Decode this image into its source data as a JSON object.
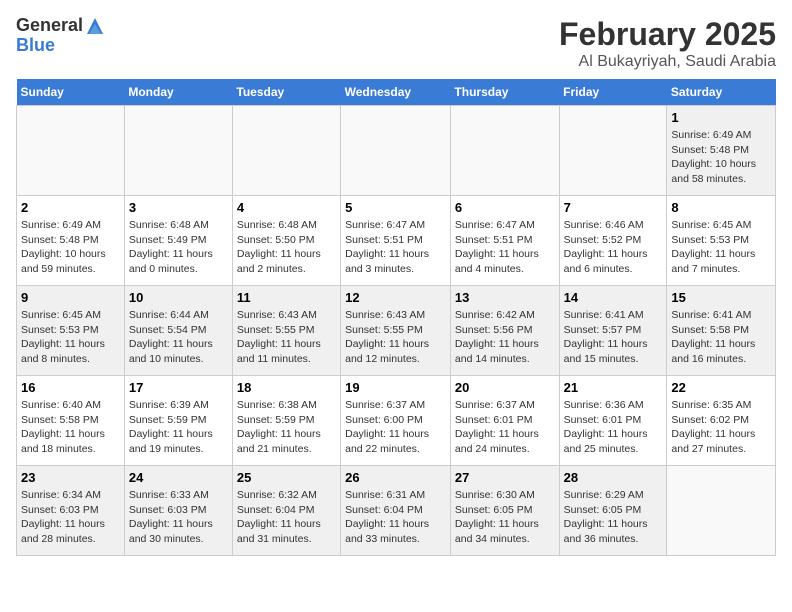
{
  "logo": {
    "general": "General",
    "blue": "Blue"
  },
  "title": "February 2025",
  "location": "Al Bukayriyah, Saudi Arabia",
  "days_of_week": [
    "Sunday",
    "Monday",
    "Tuesday",
    "Wednesday",
    "Thursday",
    "Friday",
    "Saturday"
  ],
  "weeks": [
    [
      {
        "day": "",
        "content": ""
      },
      {
        "day": "",
        "content": ""
      },
      {
        "day": "",
        "content": ""
      },
      {
        "day": "",
        "content": ""
      },
      {
        "day": "",
        "content": ""
      },
      {
        "day": "",
        "content": ""
      },
      {
        "day": "1",
        "content": "Sunrise: 6:49 AM\nSunset: 5:48 PM\nDaylight: 10 hours and 58 minutes."
      }
    ],
    [
      {
        "day": "2",
        "content": "Sunrise: 6:49 AM\nSunset: 5:48 PM\nDaylight: 10 hours and 59 minutes."
      },
      {
        "day": "3",
        "content": "Sunrise: 6:48 AM\nSunset: 5:49 PM\nDaylight: 11 hours and 0 minutes."
      },
      {
        "day": "4",
        "content": "Sunrise: 6:48 AM\nSunset: 5:50 PM\nDaylight: 11 hours and 2 minutes."
      },
      {
        "day": "5",
        "content": "Sunrise: 6:47 AM\nSunset: 5:51 PM\nDaylight: 11 hours and 3 minutes."
      },
      {
        "day": "6",
        "content": "Sunrise: 6:47 AM\nSunset: 5:51 PM\nDaylight: 11 hours and 4 minutes."
      },
      {
        "day": "7",
        "content": "Sunrise: 6:46 AM\nSunset: 5:52 PM\nDaylight: 11 hours and 6 minutes."
      },
      {
        "day": "8",
        "content": "Sunrise: 6:45 AM\nSunset: 5:53 PM\nDaylight: 11 hours and 7 minutes."
      }
    ],
    [
      {
        "day": "9",
        "content": "Sunrise: 6:45 AM\nSunset: 5:53 PM\nDaylight: 11 hours and 8 minutes."
      },
      {
        "day": "10",
        "content": "Sunrise: 6:44 AM\nSunset: 5:54 PM\nDaylight: 11 hours and 10 minutes."
      },
      {
        "day": "11",
        "content": "Sunrise: 6:43 AM\nSunset: 5:55 PM\nDaylight: 11 hours and 11 minutes."
      },
      {
        "day": "12",
        "content": "Sunrise: 6:43 AM\nSunset: 5:55 PM\nDaylight: 11 hours and 12 minutes."
      },
      {
        "day": "13",
        "content": "Sunrise: 6:42 AM\nSunset: 5:56 PM\nDaylight: 11 hours and 14 minutes."
      },
      {
        "day": "14",
        "content": "Sunrise: 6:41 AM\nSunset: 5:57 PM\nDaylight: 11 hours and 15 minutes."
      },
      {
        "day": "15",
        "content": "Sunrise: 6:41 AM\nSunset: 5:58 PM\nDaylight: 11 hours and 16 minutes."
      }
    ],
    [
      {
        "day": "16",
        "content": "Sunrise: 6:40 AM\nSunset: 5:58 PM\nDaylight: 11 hours and 18 minutes."
      },
      {
        "day": "17",
        "content": "Sunrise: 6:39 AM\nSunset: 5:59 PM\nDaylight: 11 hours and 19 minutes."
      },
      {
        "day": "18",
        "content": "Sunrise: 6:38 AM\nSunset: 5:59 PM\nDaylight: 11 hours and 21 minutes."
      },
      {
        "day": "19",
        "content": "Sunrise: 6:37 AM\nSunset: 6:00 PM\nDaylight: 11 hours and 22 minutes."
      },
      {
        "day": "20",
        "content": "Sunrise: 6:37 AM\nSunset: 6:01 PM\nDaylight: 11 hours and 24 minutes."
      },
      {
        "day": "21",
        "content": "Sunrise: 6:36 AM\nSunset: 6:01 PM\nDaylight: 11 hours and 25 minutes."
      },
      {
        "day": "22",
        "content": "Sunrise: 6:35 AM\nSunset: 6:02 PM\nDaylight: 11 hours and 27 minutes."
      }
    ],
    [
      {
        "day": "23",
        "content": "Sunrise: 6:34 AM\nSunset: 6:03 PM\nDaylight: 11 hours and 28 minutes."
      },
      {
        "day": "24",
        "content": "Sunrise: 6:33 AM\nSunset: 6:03 PM\nDaylight: 11 hours and 30 minutes."
      },
      {
        "day": "25",
        "content": "Sunrise: 6:32 AM\nSunset: 6:04 PM\nDaylight: 11 hours and 31 minutes."
      },
      {
        "day": "26",
        "content": "Sunrise: 6:31 AM\nSunset: 6:04 PM\nDaylight: 11 hours and 33 minutes."
      },
      {
        "day": "27",
        "content": "Sunrise: 6:30 AM\nSunset: 6:05 PM\nDaylight: 11 hours and 34 minutes."
      },
      {
        "day": "28",
        "content": "Sunrise: 6:29 AM\nSunset: 6:05 PM\nDaylight: 11 hours and 36 minutes."
      },
      {
        "day": "",
        "content": ""
      }
    ]
  ]
}
